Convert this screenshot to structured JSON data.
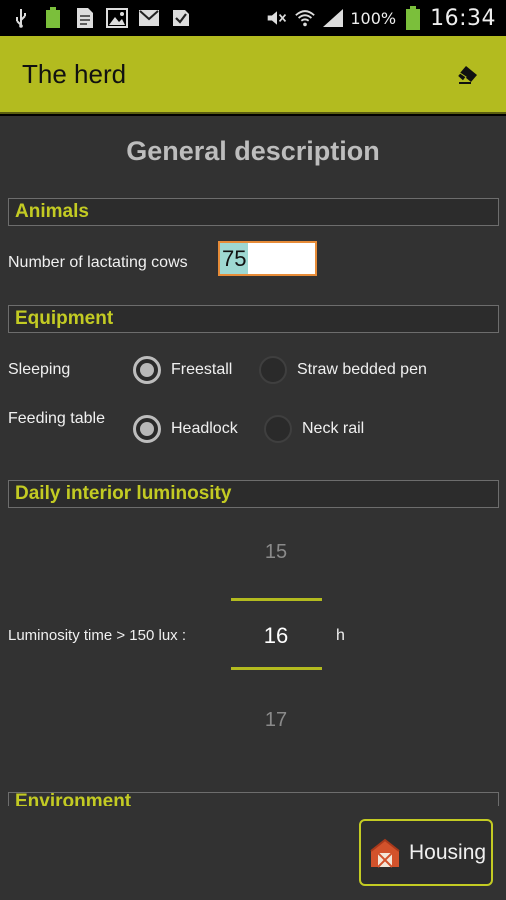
{
  "status_bar": {
    "battery_percent": "100%",
    "time": "16:34"
  },
  "action_bar": {
    "title": "The herd",
    "eraser_icon": "eraser-icon"
  },
  "page": {
    "title": "General description"
  },
  "sections": {
    "animals": {
      "header": "Animals",
      "lactating_label": "Number of lactating cows",
      "lactating_value": "75"
    },
    "equipment": {
      "header": "Equipment",
      "sleeping_label": "Sleeping",
      "sleeping_options": [
        "Freestall",
        "Straw bedded pen"
      ],
      "sleeping_selected": "Freestall",
      "feeding_label": "Feeding table",
      "feeding_options": [
        "Headlock",
        "Neck rail"
      ],
      "feeding_selected": "Headlock"
    },
    "luminosity": {
      "header": "Daily interior luminosity",
      "time_label": "Luminosity time > 150 lux :",
      "picker_prev": "15",
      "picker_current": "16",
      "picker_next": "17",
      "unit": "h"
    },
    "environment": {
      "header": "Environment"
    }
  },
  "bottom_bar": {
    "housing_label": "Housing"
  },
  "colors": {
    "accent": "#b3bb1f",
    "section_text": "#c3cb23",
    "background": "#323232",
    "input_border": "#e78c38",
    "selection": "#9ed8d2"
  }
}
